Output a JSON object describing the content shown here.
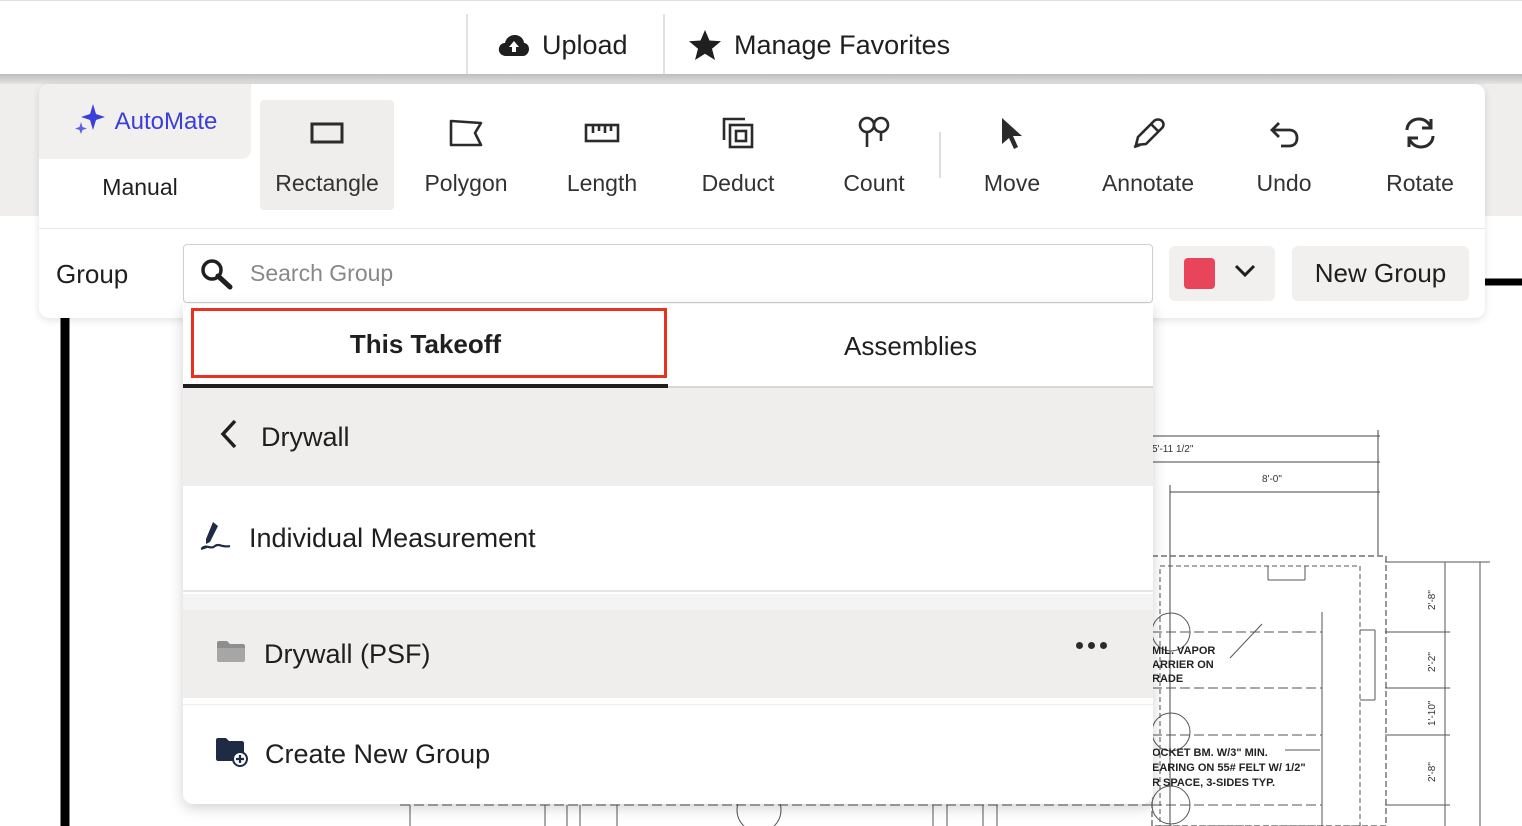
{
  "topbar": {
    "upload_label": "Upload",
    "upload_icon": "cloud-upload-icon",
    "favorites_label": "Manage Favorites",
    "favorites_icon": "star-icon"
  },
  "toolbar": {
    "automate_label": "AutoMate",
    "automate_icon": "sparkle-icon",
    "manual_label": "Manual",
    "tools": [
      {
        "label": "Rectangle",
        "icon": "rectangle-icon",
        "active": true
      },
      {
        "label": "Polygon",
        "icon": "polygon-icon",
        "active": false
      },
      {
        "label": "Length",
        "icon": "ruler-icon",
        "active": false
      },
      {
        "label": "Deduct",
        "icon": "deduct-icon",
        "active": false
      },
      {
        "label": "Count",
        "icon": "count-icon",
        "active": false
      },
      {
        "label": "Move",
        "icon": "pointer-icon",
        "active": false
      },
      {
        "label": "Annotate",
        "icon": "pencil-icon",
        "active": false
      },
      {
        "label": "Undo",
        "icon": "undo-icon",
        "active": false
      },
      {
        "label": "Rotate",
        "icon": "rotate-icon",
        "active": false
      }
    ]
  },
  "group_bar": {
    "label": "Group",
    "search_placeholder": "Search Group",
    "search_value": "",
    "selected_color": "#e8445a",
    "new_group_label": "New Group"
  },
  "dropdown": {
    "tabs": [
      {
        "label": "This Takeoff",
        "active": true
      },
      {
        "label": "Assemblies",
        "active": false
      }
    ],
    "breadcrumb": "Drywall",
    "individual_label": "Individual Measurement",
    "folder_label": "Drywall (PSF)",
    "create_label": "Create New Group"
  },
  "drawing": {
    "dimensions": [
      "5'-11 1/2\"",
      "8'-0\"",
      "2'-8\"",
      "2'-2\"",
      "1'-10\"",
      "2'-8\""
    ],
    "notes": [
      "MIL. VAPOR",
      "ARRIER ON",
      "RADE",
      "OCKET BM. W/3\" MIN.",
      "EARING ON 55# FELT W/ 1/2\"",
      "R SPACE, 3-SIDES TYP."
    ]
  },
  "colors": {
    "accent": "#3b3fd8",
    "highlight": "#e8321e",
    "panel_gray": "#efeeec"
  }
}
